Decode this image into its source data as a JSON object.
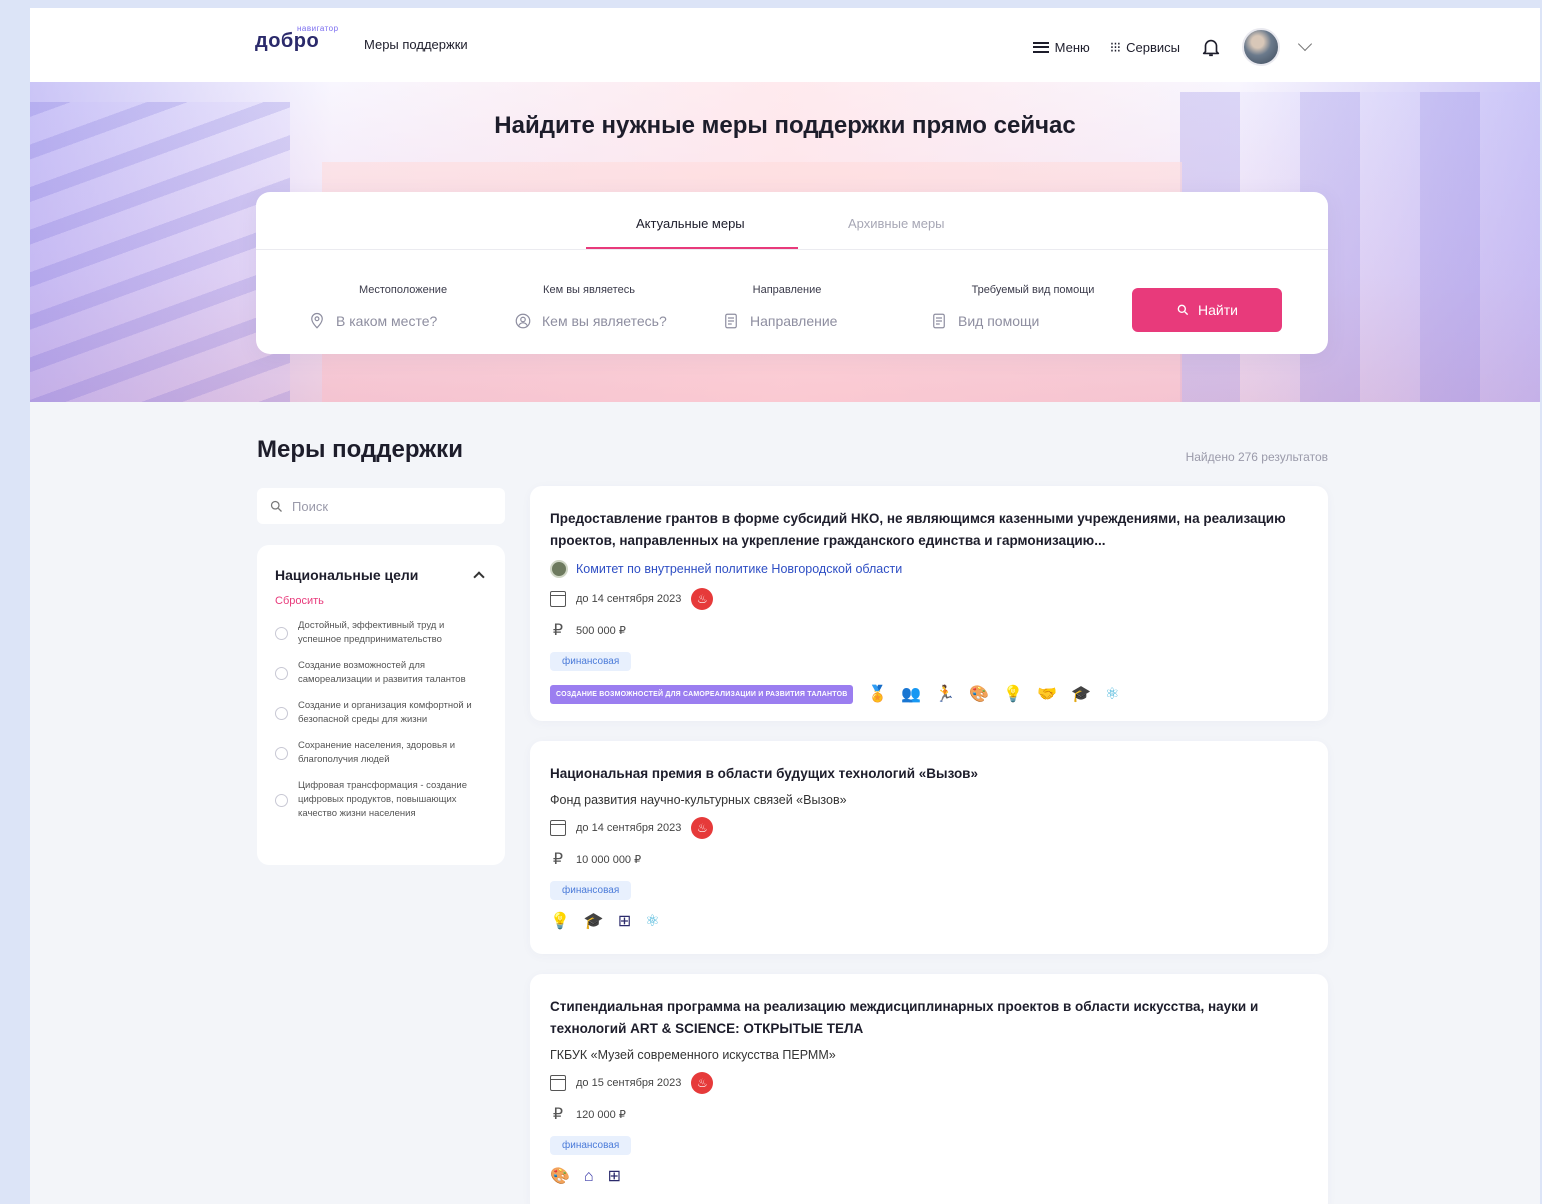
{
  "header": {
    "logo": "добро",
    "logo_sub": "навигатор",
    "section": "Меры поддержки",
    "menu_label": "Меню",
    "services_label": "Сервисы"
  },
  "hero": {
    "title": "Найдите нужные меры поддержки прямо сейчас"
  },
  "search": {
    "tabs": [
      {
        "label": "Актуальные меры",
        "active": true
      },
      {
        "label": "Архивные меры",
        "active": false
      }
    ],
    "fields": [
      {
        "label": "Местоположение",
        "placeholder": "В каком месте?",
        "icon": "location-icon"
      },
      {
        "label": "Кем вы являетесь",
        "placeholder": "Кем вы являетесь?",
        "icon": "user-icon"
      },
      {
        "label": "Направление",
        "placeholder": "Направление",
        "icon": "document-icon"
      },
      {
        "label": "Требуемый вид помощи",
        "placeholder": "Вид помощи",
        "icon": "document-icon"
      }
    ],
    "button": "Найти",
    "accent": "#e83a7b"
  },
  "main": {
    "title": "Меры поддержки",
    "results": "Найдено 276 результатов"
  },
  "sidebar": {
    "search_placeholder": "Поиск",
    "filter_title": "Национальные цели",
    "reset": "Сбросить",
    "options": [
      "Достойный, эффективный труд и успешное предпринимательство",
      "Создание возможностей для самореализации и развития талантов",
      "Создание и организация комфортной и безопасной среды для жизни",
      "Сохранение населения, здоровья и благополучия людей",
      "Цифровая трансформация - создание цифровых продуктов, повышающих качество жизни населения"
    ]
  },
  "cards": [
    {
      "title": "Предоставление грантов в форме субсидий НКО, не являющимся казенными учреждениями, на реализацию проектов, направленных на укрепление гражданского единства и гармонизацию...",
      "org": "Комитет по внутренней политике Новгородской области",
      "deadline": "до 14 сентября 2023",
      "amount": "500 000 ₽",
      "tag": "финансовая",
      "goal_badge": "СОЗДАНИЕ ВОЗМОЖНОСТЕЙ ДЛЯ САМОРЕАЛИЗАЦИИ И РАЗВИТИЯ ТАЛАНТОВ",
      "goal_icons": [
        "medal-icon",
        "people-icon",
        "runner-icon",
        "palette-icon",
        "bulb-icon",
        "handshake-icon",
        "graduation-icon",
        "atom-icon"
      ]
    },
    {
      "title": "Национальная премия в области будущих технологий «Вызов»",
      "org": "Фонд развития научно-культурных связей «Вызов»",
      "deadline": "до 14 сентября 2023",
      "amount": "10 000 000 ₽",
      "tag": "финансовая",
      "goal_icons": [
        "bulb-icon",
        "graduation-icon",
        "grid-icon",
        "atom-icon"
      ]
    },
    {
      "title": "Стипендиальная программа на реализацию междисциплинарных проектов в области искусства, науки и технологий ART & SCIENCE: ОТКРЫТЫЕ ТЕЛА",
      "org": "ГКБУК «Музей современного искусства ПЕРММ»",
      "deadline": "до 15 сентября 2023",
      "amount": "120 000 ₽",
      "tag": "финансовая",
      "goal_icons": [
        "palette-icon",
        "house-icon",
        "grid-icon"
      ]
    }
  ]
}
